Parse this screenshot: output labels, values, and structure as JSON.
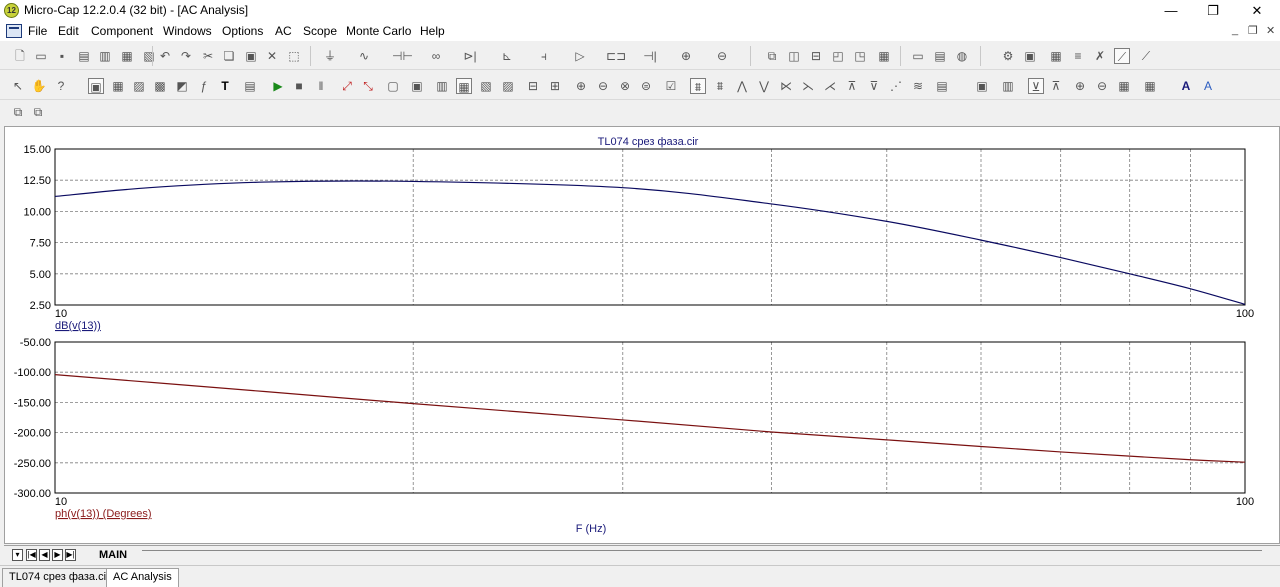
{
  "window": {
    "title": "Micro-Cap 12.2.0.4 (32 bit) - [AC Analysis]",
    "app_icon_text": "12",
    "controls": {
      "minimize": "—",
      "restore": "❐",
      "close": "✕"
    }
  },
  "menubar": {
    "items": [
      "File",
      "Edit",
      "Component",
      "Windows",
      "Options",
      "AC",
      "Scope",
      "Monte Carlo",
      "Help"
    ],
    "mdi_controls": {
      "minimize": "_",
      "restore": "❐",
      "close": "✕"
    }
  },
  "plot": {
    "title": "TL074 срез фаза.cir",
    "xlabel": "F (Hz)",
    "colors": {
      "mag": "#0a0a60",
      "phase": "#7a1010",
      "grid": "#7f7f7f",
      "axis": "#000000"
    }
  },
  "chart_data": [
    {
      "type": "line",
      "xscale": "log",
      "xlim": [
        10,
        100
      ],
      "ylim": [
        2.5,
        15
      ],
      "yticks": [
        "15.00",
        "12.50",
        "10.00",
        "7.50",
        "5.00",
        "2.50"
      ],
      "xticks": [
        "10",
        "100"
      ],
      "ylabel": "dB(v(13))",
      "series": [
        {
          "name": "dB(v(13))",
          "x": [
            10,
            12,
            15,
            20,
            30,
            40,
            50,
            60,
            70,
            80,
            90,
            100
          ],
          "y": [
            11.2,
            11.9,
            12.35,
            12.4,
            11.9,
            10.6,
            9.2,
            7.7,
            6.3,
            5.0,
            3.8,
            2.55
          ]
        }
      ]
    },
    {
      "type": "line",
      "xscale": "log",
      "xlim": [
        10,
        100
      ],
      "ylim": [
        -300,
        -50
      ],
      "yticks": [
        "-50.00",
        "-100.00",
        "-150.00",
        "-200.00",
        "-250.00",
        "-300.00"
      ],
      "xticks": [
        "10",
        "100"
      ],
      "ylabel": "ph(v(13)) (Degrees)",
      "series": [
        {
          "name": "ph(v(13)) (Degrees)",
          "x": [
            10,
            15,
            20,
            30,
            40,
            50,
            60,
            70,
            80,
            90,
            100
          ],
          "y": [
            -104,
            -132,
            -152,
            -179,
            -199,
            -212,
            -223,
            -232,
            -239,
            -245,
            -249
          ]
        }
      ]
    }
  ],
  "tabs": {
    "main": "MAIN",
    "nav": [
      "▾",
      "|◀",
      "◀",
      "▶",
      "▶|"
    ]
  },
  "status_tabs": [
    "TL074 срез фаза.cir",
    "AC Analysis"
  ]
}
